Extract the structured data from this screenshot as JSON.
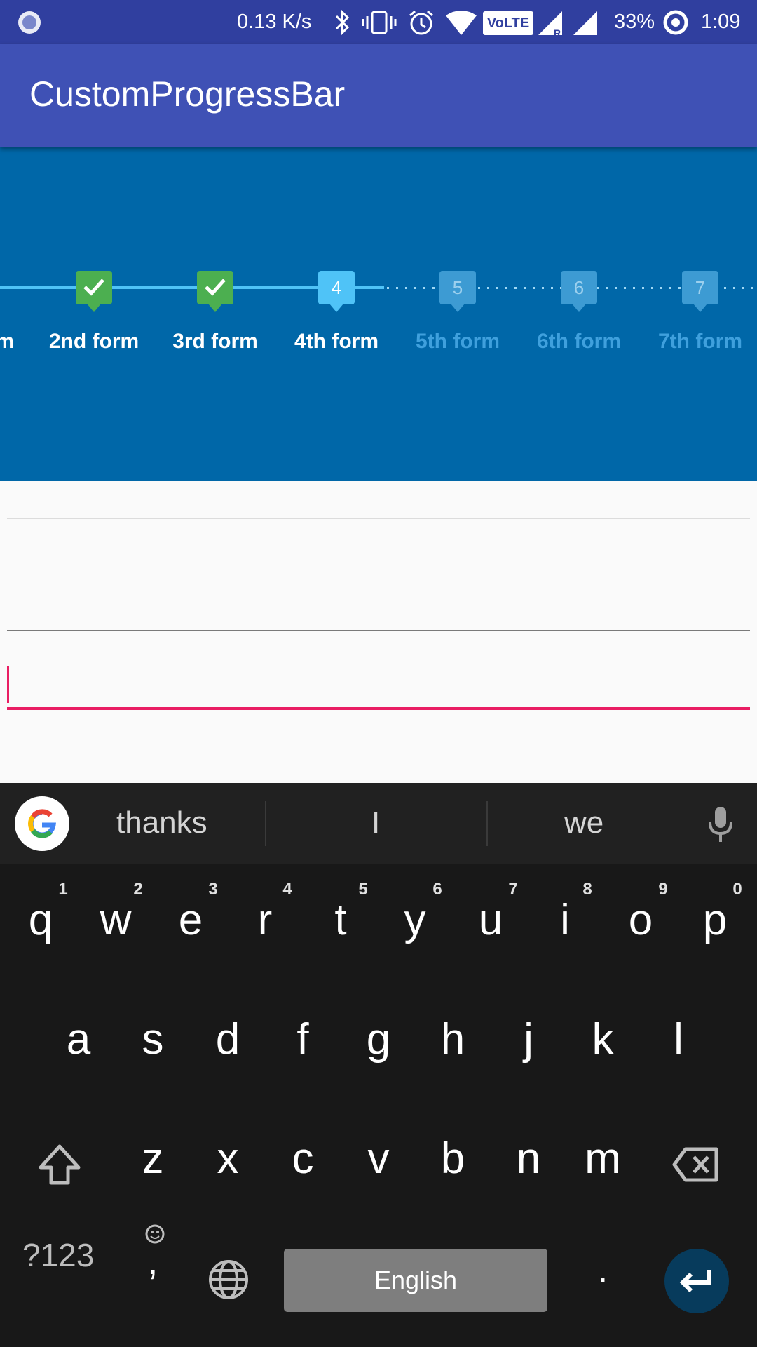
{
  "status_bar": {
    "speed": "0.13 K/s",
    "volte": "VoLTE",
    "battery": "33%",
    "time": "1:09",
    "icons": [
      "app-notification-icon",
      "bluetooth-icon",
      "vibrate-icon",
      "alarm-icon",
      "wifi-icon",
      "volte-icon",
      "signal-roaming-icon",
      "signal-icon",
      "battery-icon"
    ]
  },
  "app_bar": {
    "title": "CustomProgressBar"
  },
  "stepper": {
    "first_label_fragment": "m",
    "steps": [
      {
        "label": "2nd form",
        "state": "completed"
      },
      {
        "label": "3rd form",
        "state": "completed"
      },
      {
        "label": "4th form",
        "state": "current",
        "number": "4"
      },
      {
        "label": "5th form",
        "state": "pending",
        "number": "5"
      },
      {
        "label": "6th form",
        "state": "pending",
        "number": "6"
      },
      {
        "label": "7th form",
        "state": "pending",
        "number": "7"
      }
    ]
  },
  "keyboard": {
    "suggestions": [
      "thanks",
      "I",
      "we"
    ],
    "row1": [
      "q",
      "w",
      "e",
      "r",
      "t",
      "y",
      "u",
      "i",
      "o",
      "p"
    ],
    "row1_hints": [
      "1",
      "2",
      "3",
      "4",
      "5",
      "6",
      "7",
      "8",
      "9",
      "0"
    ],
    "row2": [
      "a",
      "s",
      "d",
      "f",
      "g",
      "h",
      "j",
      "k",
      "l"
    ],
    "row3": [
      "z",
      "x",
      "c",
      "v",
      "b",
      "n",
      "m"
    ],
    "symbols_key": "?123",
    "comma_key": ",",
    "space_label": "English",
    "period_key": ".",
    "colors": {
      "accent": "#e91e63",
      "primary": "#3f51b5",
      "primary_dark": "#303f9f",
      "stepper_bg": "#0067a8",
      "enter_key": "#073b5c"
    }
  }
}
